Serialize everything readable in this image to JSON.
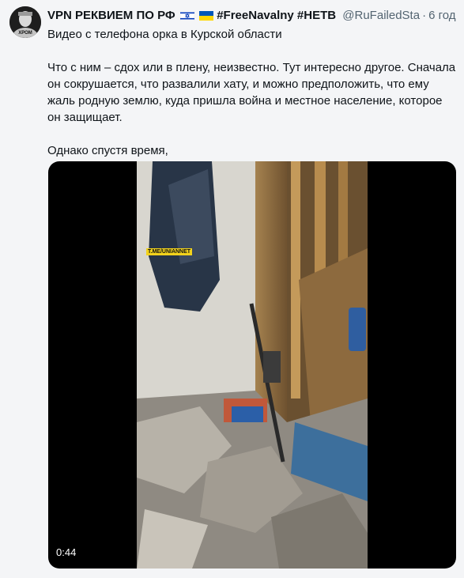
{
  "tweet": {
    "display_name": "VPN РЕКВИЕМ ПО РФ",
    "hashtags": "#FreeNavalny #НЕТВ",
    "handle": "@RuFailedSta",
    "time": "6 год",
    "avatar_text": "ХРОМ",
    "paragraphs": [
      "Видео с телефона орка в Курской области",
      "Что с ним – сдох или в плену, неизвестно. Тут интересно другое. Сначала он сокрушается, что развалили хату, и можно предположить, что ему жаль родную землю, куда пришла война и местное население, которое он защищает.",
      "Однако спустя время,"
    ]
  },
  "video": {
    "watermark": "T.ME/UNIANNET",
    "duration": "0:44"
  },
  "icons": {
    "flag_1": "israel-flag-icon",
    "flag_2": "ukraine-flag-icon"
  },
  "colors": {
    "text": "#0f1419",
    "muted": "#536471",
    "background": "#f4f5f7"
  }
}
